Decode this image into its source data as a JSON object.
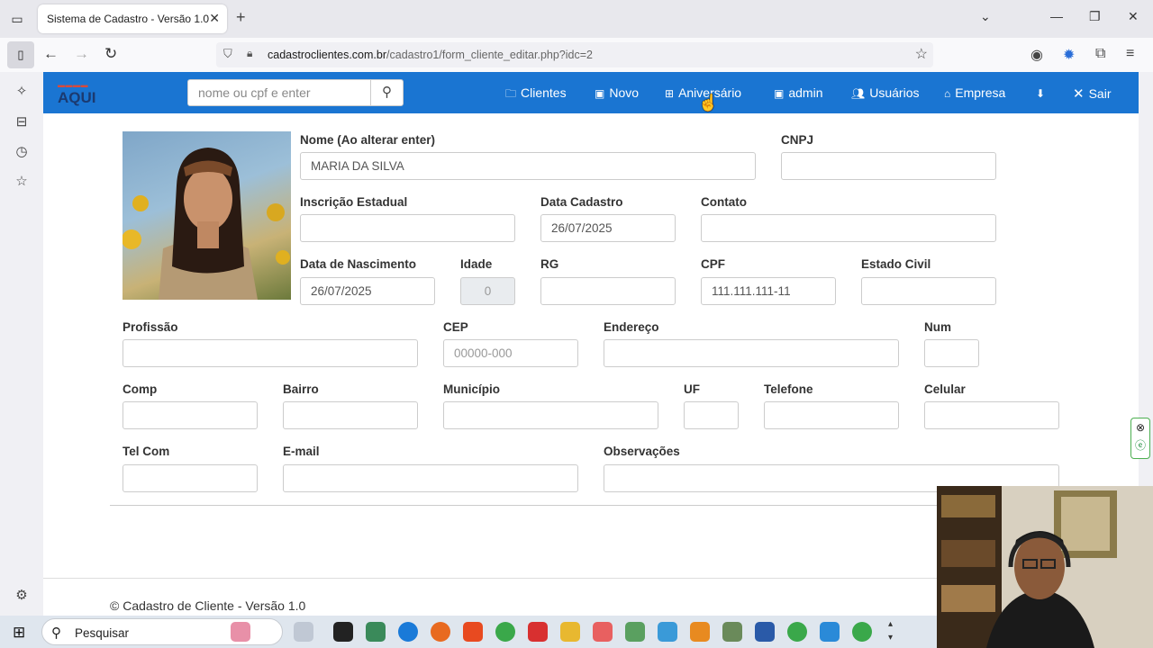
{
  "browser": {
    "tab_title": "Sistema de Cadastro - Versão 1.0",
    "tab_close": "✕",
    "new_tab": "+",
    "url_domain": "cadastroclientes.com.br",
    "url_path": "/cadastro1/form_cliente_editar.php?idc=2"
  },
  "navbar": {
    "brand": "AQUI",
    "search_placeholder": "nome ou cpf e enter",
    "items": [
      {
        "label": "Clientes",
        "icon": "folder-icon"
      },
      {
        "label": "Novo",
        "icon": "id-card-icon"
      },
      {
        "label": "Aniversário",
        "icon": "gift-icon"
      },
      {
        "label": "admin",
        "icon": "id-badge-icon"
      },
      {
        "label": "Usuários",
        "icon": "users-icon"
      },
      {
        "label": "Empresa",
        "icon": "home-icon"
      },
      {
        "label": "",
        "icon": "download-icon"
      },
      {
        "label": "Sair",
        "icon": "close-icon"
      }
    ]
  },
  "form": {
    "nome": {
      "label": "Nome (Ao alterar enter)",
      "value": "MARIA DA SILVA"
    },
    "cnpj": {
      "label": "CNPJ",
      "value": ""
    },
    "inscricao": {
      "label": "Inscrição Estadual",
      "value": ""
    },
    "data_cadastro": {
      "label": "Data Cadastro",
      "value": "26/07/2025"
    },
    "contato": {
      "label": "Contato",
      "value": ""
    },
    "data_nascimento": {
      "label": "Data de Nascimento",
      "value": "26/07/2025"
    },
    "idade": {
      "label": "Idade",
      "value": "0"
    },
    "rg": {
      "label": "RG",
      "value": ""
    },
    "cpf": {
      "label": "CPF",
      "value": "111.111.111-11"
    },
    "estado_civil": {
      "label": "Estado Civil",
      "value": ""
    },
    "profissao": {
      "label": "Profissão",
      "value": ""
    },
    "cep": {
      "label": "CEP",
      "placeholder": "00000-000"
    },
    "endereco": {
      "label": "Endereço",
      "value": ""
    },
    "num": {
      "label": "Num",
      "value": ""
    },
    "comp": {
      "label": "Comp",
      "value": ""
    },
    "bairro": {
      "label": "Bairro",
      "value": ""
    },
    "municipio": {
      "label": "Município",
      "value": ""
    },
    "uf": {
      "label": "UF",
      "value": ""
    },
    "telefone": {
      "label": "Telefone",
      "value": ""
    },
    "celular": {
      "label": "Celular",
      "value": ""
    },
    "tel_com": {
      "label": "Tel Com",
      "value": ""
    },
    "email": {
      "label": "E-mail",
      "value": ""
    },
    "observacoes": {
      "label": "Observações",
      "value": ""
    }
  },
  "footer": "© Cadastro de Cliente - Versão 1.0",
  "taskbar": {
    "search_label": "Pesquisar"
  },
  "colors": {
    "navbar": "#1a75d2",
    "taskbar": "#dfe6ee"
  }
}
